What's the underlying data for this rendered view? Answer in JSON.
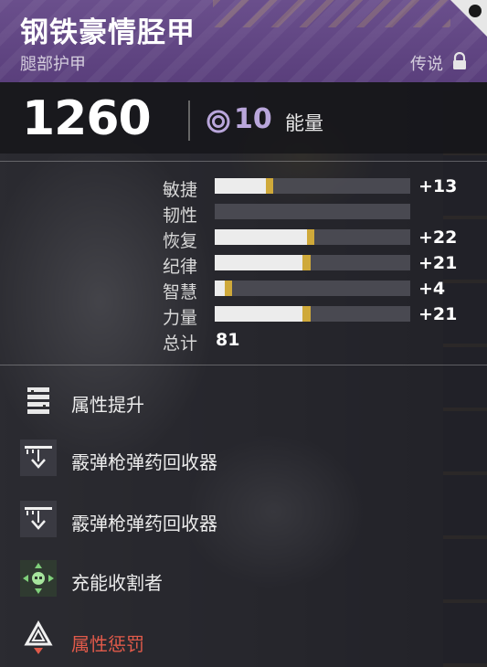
{
  "item": {
    "name": "钢铁豪情胫甲",
    "type": "腿部护甲",
    "tier": "传说"
  },
  "power": {
    "level": "1260",
    "energy_value": "10",
    "energy_label": "能量",
    "energy_color": "#b9a6db"
  },
  "stats": [
    {
      "label": "敏捷",
      "value": "+13",
      "base_fraction": 0.26,
      "mod_fraction": 0.04
    },
    {
      "label": "韧性",
      "value": "",
      "base_fraction": 0,
      "mod_fraction": 0
    },
    {
      "label": "恢复",
      "value": "+22",
      "base_fraction": 0.47,
      "mod_fraction": 0.04
    },
    {
      "label": "纪律",
      "value": "+21",
      "base_fraction": 0.45,
      "mod_fraction": 0.04
    },
    {
      "label": "智慧",
      "value": "+4",
      "base_fraction": 0.05,
      "mod_fraction": 0.04
    },
    {
      "label": "力量",
      "value": "+21",
      "base_fraction": 0.45,
      "mod_fraction": 0.04
    }
  ],
  "total": {
    "label": "总计",
    "value": "81"
  },
  "perks": [
    {
      "label": "属性提升",
      "icon": "stat-boost-icon"
    },
    {
      "label": "霰弹枪弹药回收器",
      "icon": "shotgun-scavenger-icon"
    },
    {
      "label": "霰弹枪弹药回收器",
      "icon": "shotgun-scavenger-icon"
    },
    {
      "label": "充能收割者",
      "icon": "charged-harvester-icon"
    },
    {
      "label": "属性惩罚",
      "icon": "stat-penalty-icon",
      "color": "#e05a4a"
    }
  ],
  "colors": {
    "header": "#5a3f7c",
    "masterwork_gold": "#cfa93a",
    "penalty_red": "#e05a4a"
  }
}
